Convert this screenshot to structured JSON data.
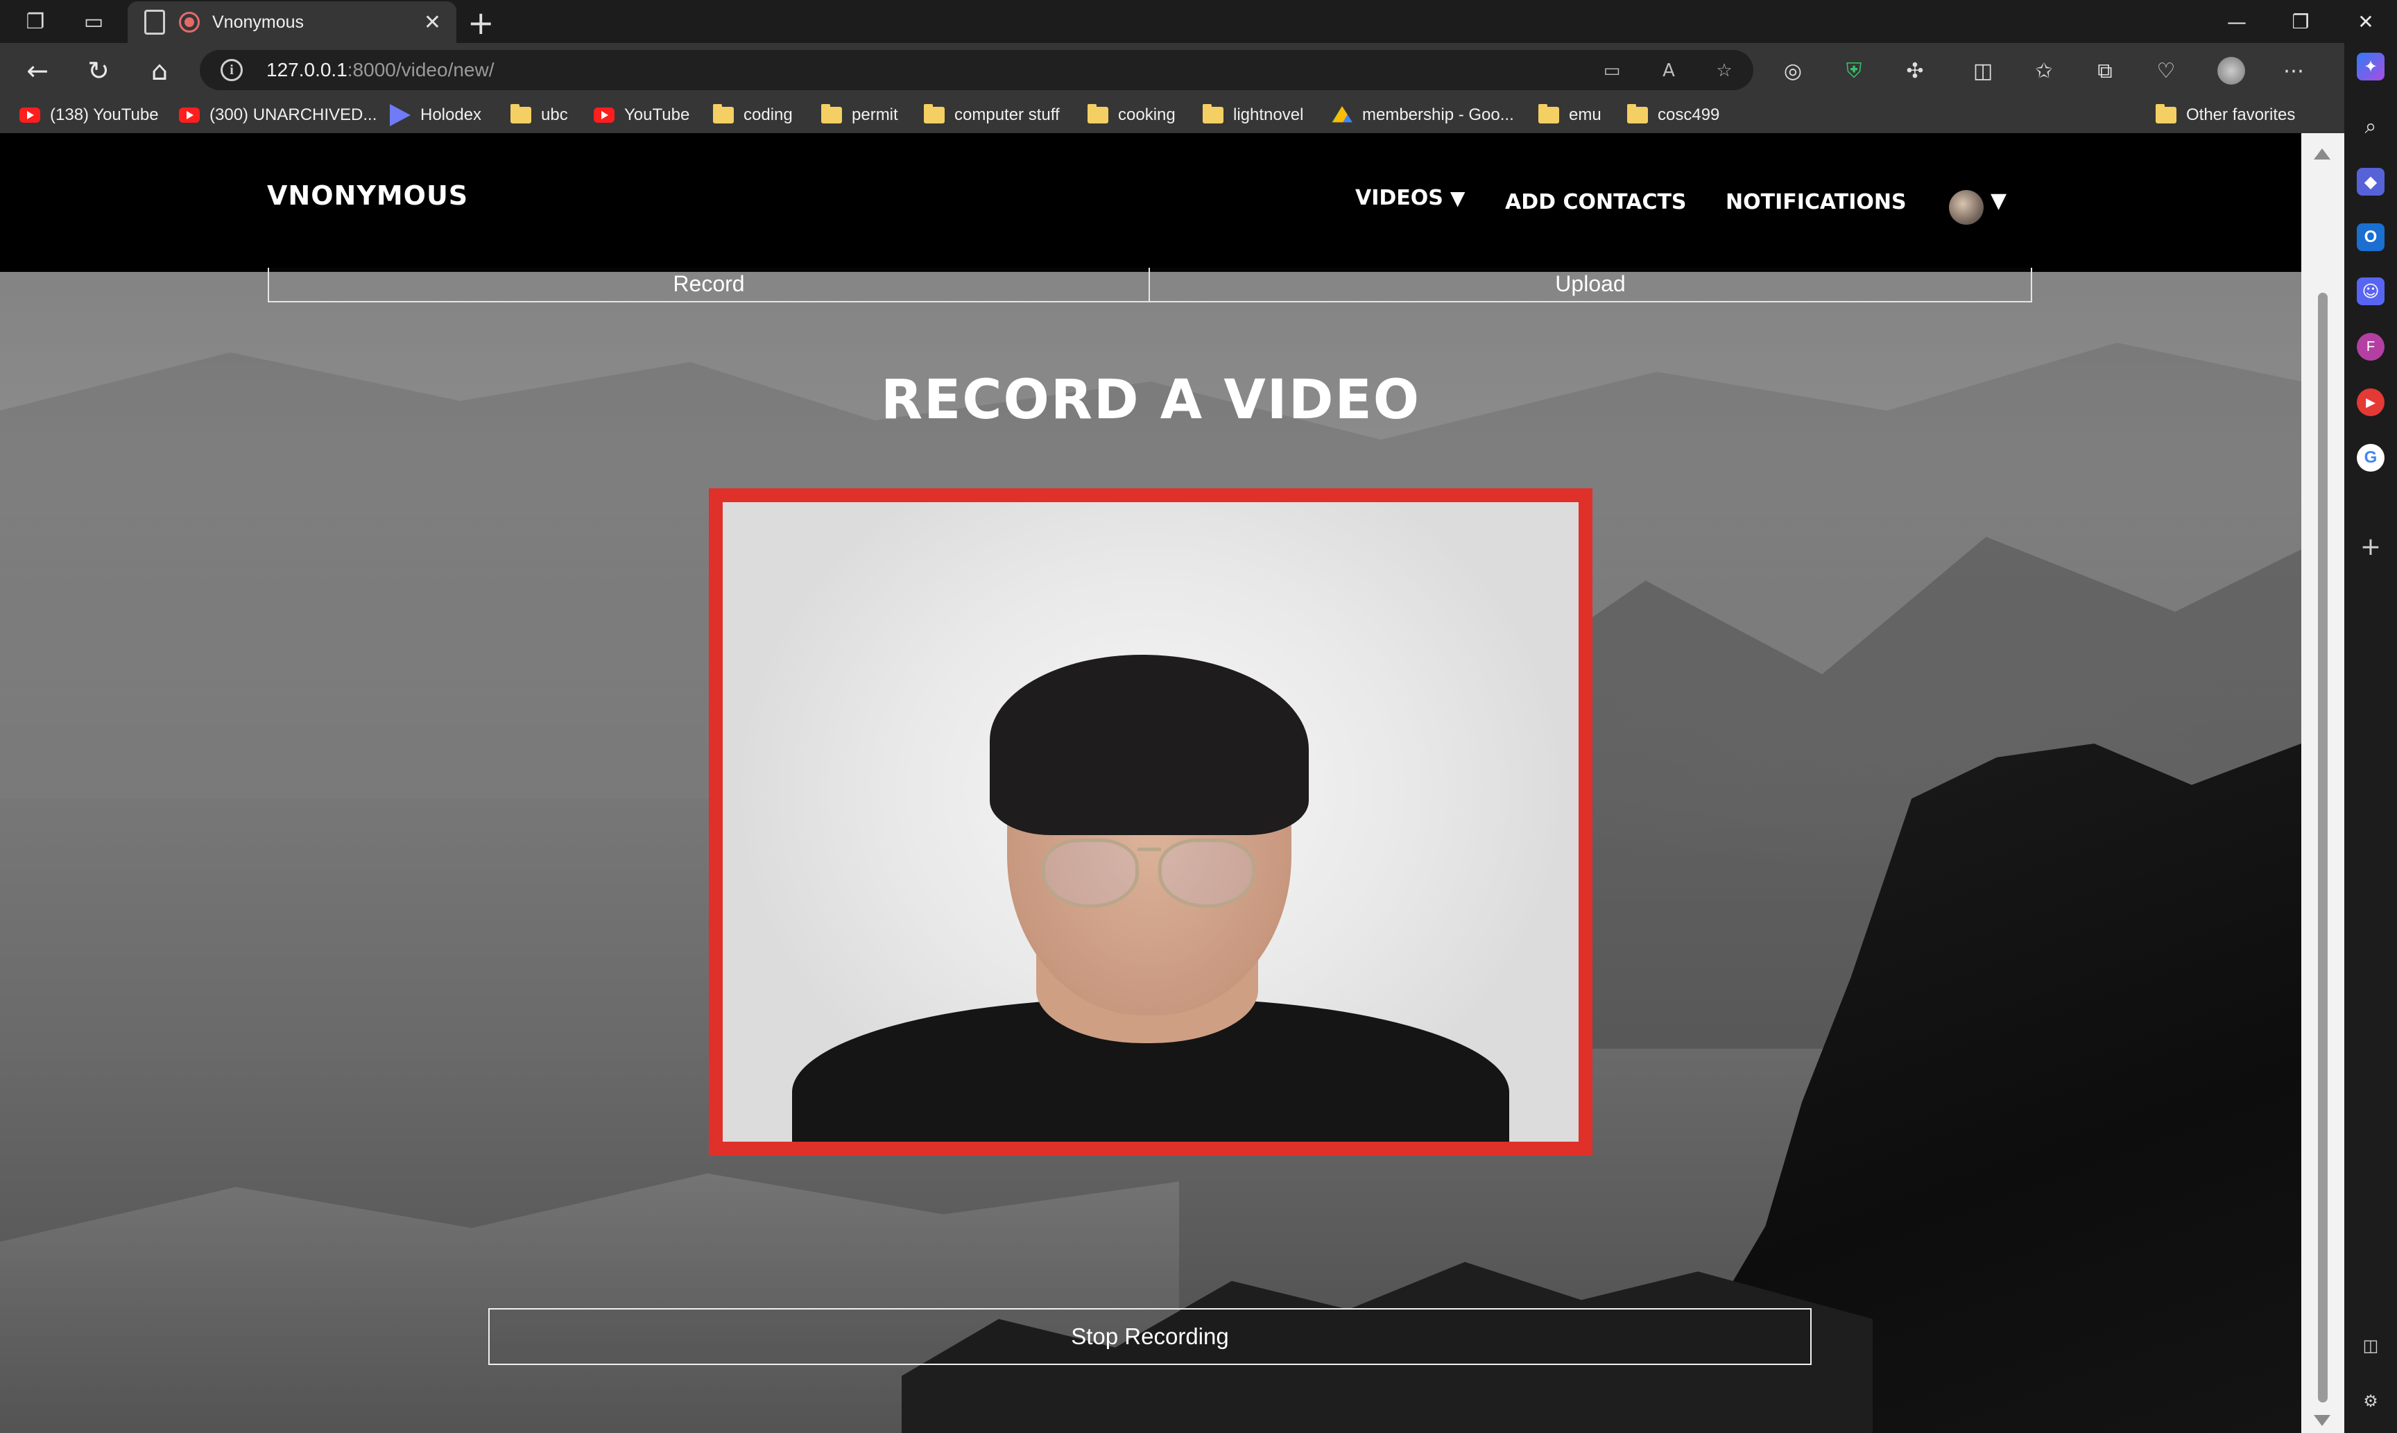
{
  "browser": {
    "tab_title": "Vnonymous",
    "url_host": "127.0.0.1",
    "url_path": ":8000/video/new/",
    "bookmarks": [
      {
        "label": "(138) YouTube",
        "icon": "youtube-icon"
      },
      {
        "label": "(300) UNARCHIVED...",
        "icon": "youtube-icon"
      },
      {
        "label": "Holodex",
        "icon": "holodex-icon"
      },
      {
        "label": "ubc",
        "icon": "folder-icon"
      },
      {
        "label": "YouTube",
        "icon": "youtube-icon"
      },
      {
        "label": "coding",
        "icon": "folder-icon"
      },
      {
        "label": "permit",
        "icon": "folder-icon"
      },
      {
        "label": "computer stuff",
        "icon": "folder-icon"
      },
      {
        "label": "cooking",
        "icon": "folder-icon"
      },
      {
        "label": "lightnovel",
        "icon": "folder-icon"
      },
      {
        "label": "membership - Goo...",
        "icon": "google-drive-icon"
      },
      {
        "label": "emu",
        "icon": "folder-icon"
      },
      {
        "label": "cosc499",
        "icon": "folder-icon"
      }
    ],
    "other_favorites": "Other favorites",
    "accent_record": "#e46a6a"
  },
  "site": {
    "brand": "VNONYMOUS",
    "menu": {
      "videos": "VIDEOS",
      "videos_caret": "▼",
      "add_contacts": "ADD CONTACTS",
      "notifications": "NOTIFICATIONS",
      "profile_caret": "▼"
    }
  },
  "modes": {
    "record": "Record",
    "upload": "Upload"
  },
  "main": {
    "heading": "RECORD A VIDEO",
    "frame_color": "#e0302a",
    "stop_button": "Stop Recording"
  }
}
